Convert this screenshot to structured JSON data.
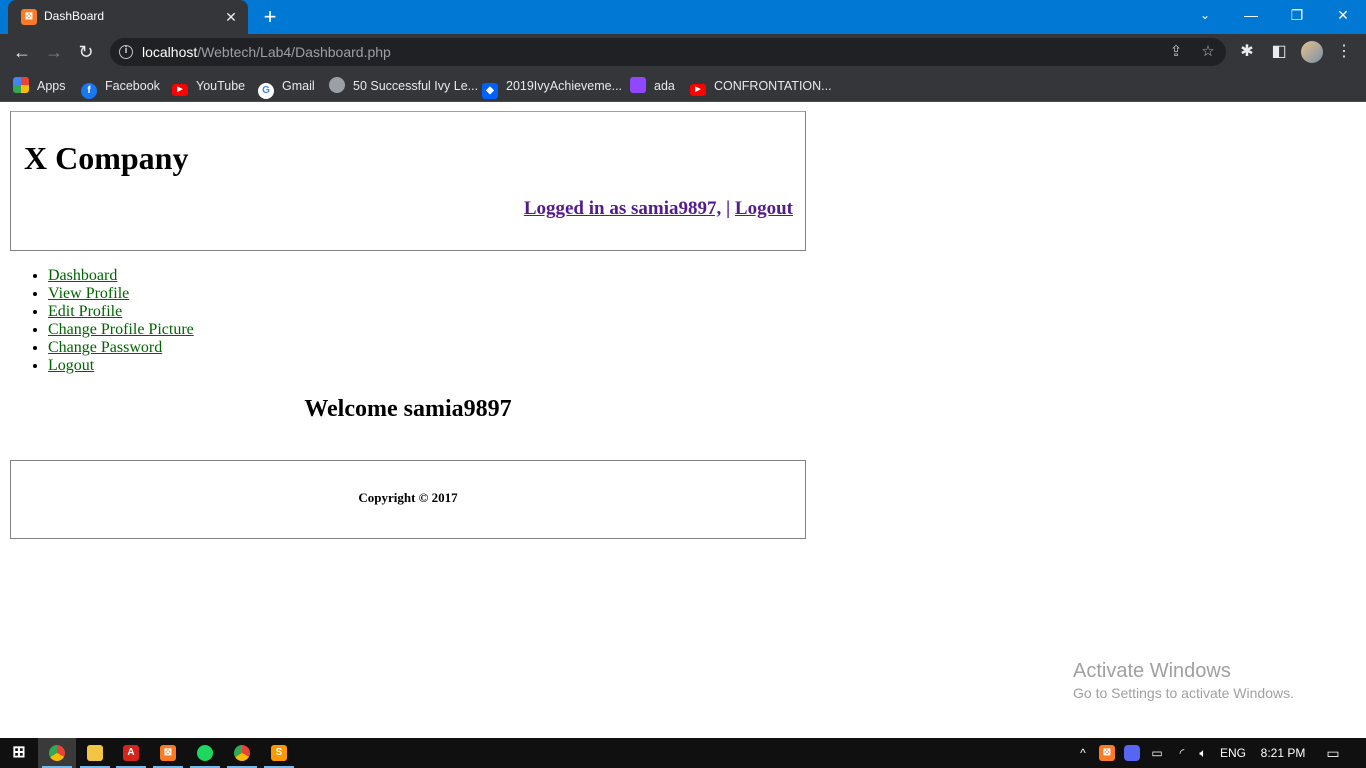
{
  "browser": {
    "tab_title": "DashBoard",
    "url_host": "localhost",
    "url_path": "/Webtech/Lab4/Dashboard.php",
    "bookmarks": [
      {
        "label": "Apps",
        "icon": "apps-grid-icon"
      },
      {
        "label": "Facebook",
        "icon": "facebook-icon"
      },
      {
        "label": "YouTube",
        "icon": "youtube-icon"
      },
      {
        "label": "Gmail",
        "icon": "google-icon"
      },
      {
        "label": "50 Successful Ivy Le...",
        "icon": "globe-icon"
      },
      {
        "label": "2019IvyAchieveme...",
        "icon": "dropbox-icon"
      },
      {
        "label": "ada",
        "icon": "twitch-icon"
      },
      {
        "label": "CONFRONTATION...",
        "icon": "youtube-icon"
      }
    ]
  },
  "page": {
    "company": "X Company",
    "logged_in_text": "Logged in as samia9897,",
    "separator": "|",
    "logout_link": "Logout",
    "menu": [
      "Dashboard",
      "View Profile",
      "Edit Profile",
      "Change Profile Picture",
      "Change Password",
      "Logout"
    ],
    "welcome": "Welcome samia9897",
    "copyright": "Copyright © 2017"
  },
  "watermark": {
    "title": "Activate Windows",
    "subtitle": "Go to Settings to activate Windows."
  },
  "taskbar": {
    "language": "ENG",
    "time": "8:21 PM"
  },
  "colors": {
    "titlebar": "#0078d4",
    "chrome": "#35363a",
    "link_visited": "#551a8b",
    "menu_link": "#006400"
  }
}
